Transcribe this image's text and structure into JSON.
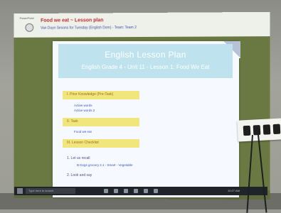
{
  "window": {
    "top_text": "PowerPoint",
    "title": "Food we eat ~ Lesson plan",
    "subtitle": "Van Duyn Sesons for Tuesday (English Dom) - Team: Team 2"
  },
  "slide": {
    "title": "English Lesson Plan",
    "subtitle": "English Grade 4 - Unit 11 - Lesson 1: Food We Eat",
    "sections": [
      {
        "heading": "I. Prior Knowledge (Pre-Task)",
        "lines": [
          "Active words",
          "Active words 2"
        ]
      },
      {
        "heading": "II. Task",
        "lines": [
          "Food we eat"
        ]
      },
      {
        "heading": "III. Lesson Checklist",
        "lines": []
      }
    ],
    "steps": [
      {
        "label": "1. Let us recall",
        "detail": "B Dogs grocery 2.1 - Smart - Vegetable"
      },
      {
        "label": "2. Look and say",
        "detail": ""
      }
    ]
  },
  "taskbar": {
    "search_placeholder": "Type here to search",
    "clock": "10:27 AM",
    "icons": [
      "windows-icon",
      "task-view-icon",
      "browser-icon",
      "folder-icon",
      "store-icon",
      "mail-icon",
      "media-icon"
    ]
  },
  "colors": {
    "banner": "#bfe3ee",
    "highlight_bar": "#f0e67c",
    "link_text": "#3a55c8",
    "canvas": "#6a7842"
  }
}
